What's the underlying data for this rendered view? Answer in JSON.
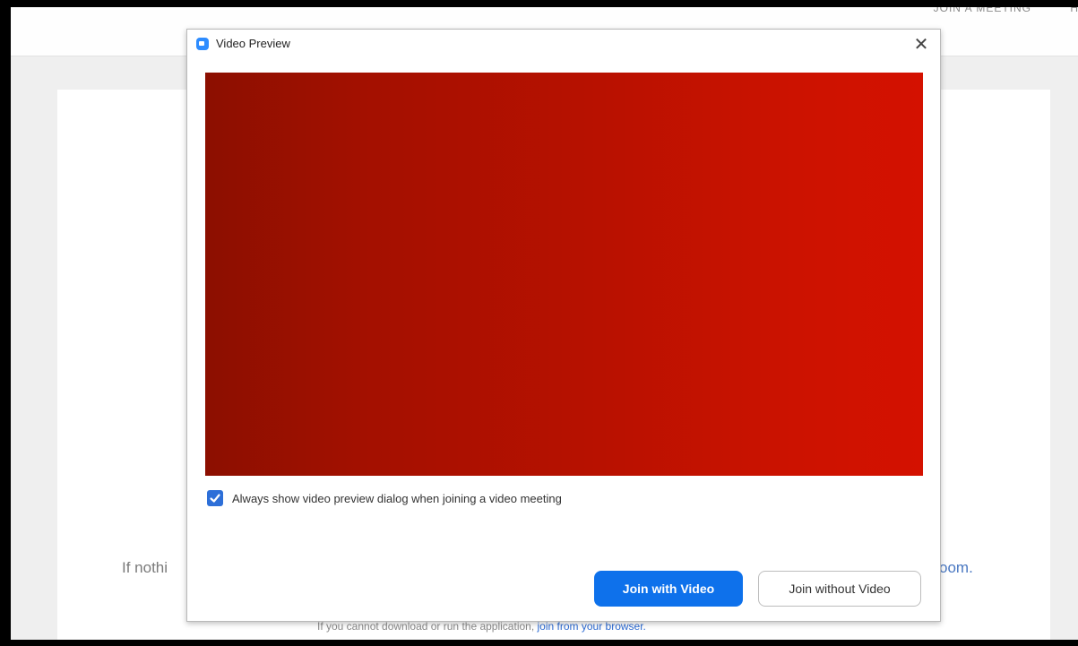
{
  "page": {
    "topbar": {
      "join_link": "JOIN A MEETING",
      "host_link": "H"
    },
    "card": {
      "nothing_text": "If nothi",
      "room_text": "oom.",
      "download_prefix": "If you cannot download or run the application, ",
      "browser_link": "join from your browser."
    }
  },
  "dialog": {
    "title": "Video Preview",
    "close_symbol": "✕",
    "checkbox_label": "Always show video preview dialog when joining a video meeting",
    "checkbox_checked": true,
    "join_with_video": "Join with Video",
    "join_without_video": "Join without Video",
    "accent_color": "#0e71eb"
  }
}
